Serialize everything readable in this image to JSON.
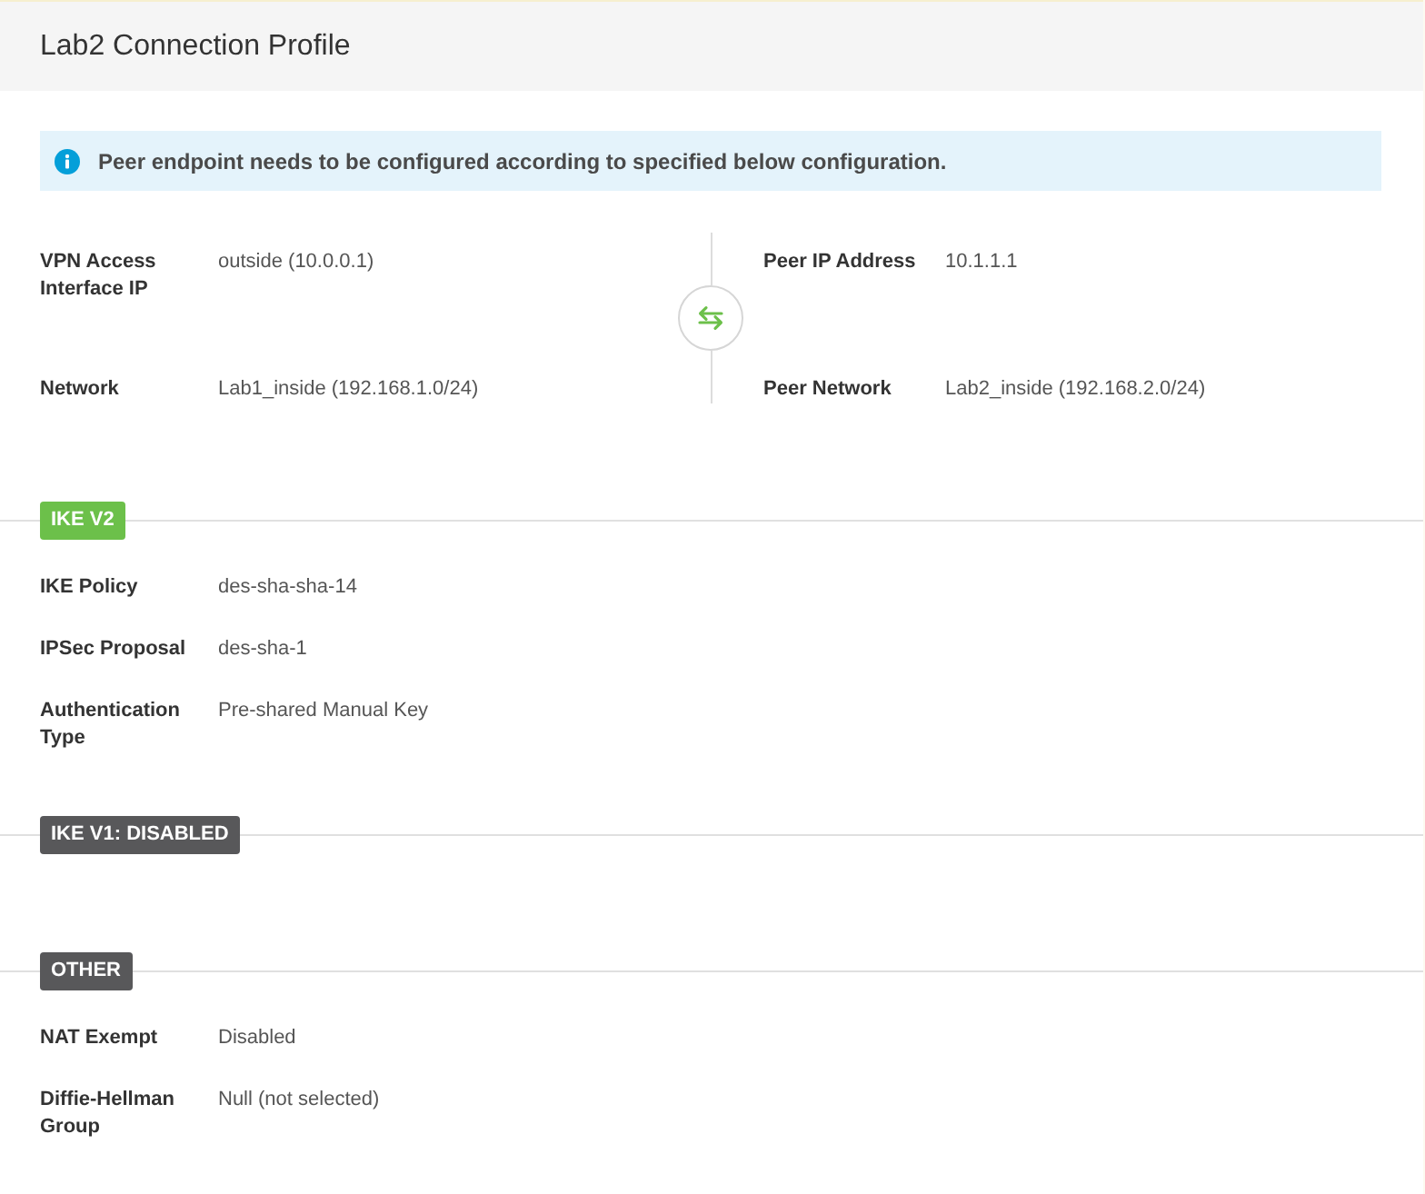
{
  "title": "Lab2 Connection Profile",
  "info_banner": {
    "text": "Peer endpoint needs to be configured according to specified below configuration."
  },
  "endpoints": {
    "local": [
      {
        "label": "VPN Access Interface IP",
        "value": "outside (10.0.0.1)"
      },
      {
        "label": "Network",
        "value": "Lab1_inside (192.168.1.0/24)"
      }
    ],
    "peer": [
      {
        "label": "Peer IP Address",
        "value": "10.1.1.1"
      },
      {
        "label": "Peer Network",
        "value": "Lab2_inside (192.168.2.0/24)"
      }
    ]
  },
  "sections": [
    {
      "badge": "IKE V2",
      "color": "#6cc04a",
      "fields": [
        {
          "label": "IKE Policy",
          "value": "des-sha-sha-14"
        },
        {
          "label": "IPSec Proposal",
          "value": "des-sha-1"
        },
        {
          "label": "Authentication Type",
          "value": "Pre-shared Manual Key"
        }
      ]
    },
    {
      "badge": "IKE V1: DISABLED",
      "color": "#58585a"
    },
    {
      "badge": "OTHER",
      "color": "#58585a",
      "fields": [
        {
          "label": "NAT Exempt",
          "value": "Disabled"
        },
        {
          "label": "Diffie-Hellman Group",
          "value": "Null (not selected)"
        }
      ]
    }
  ]
}
